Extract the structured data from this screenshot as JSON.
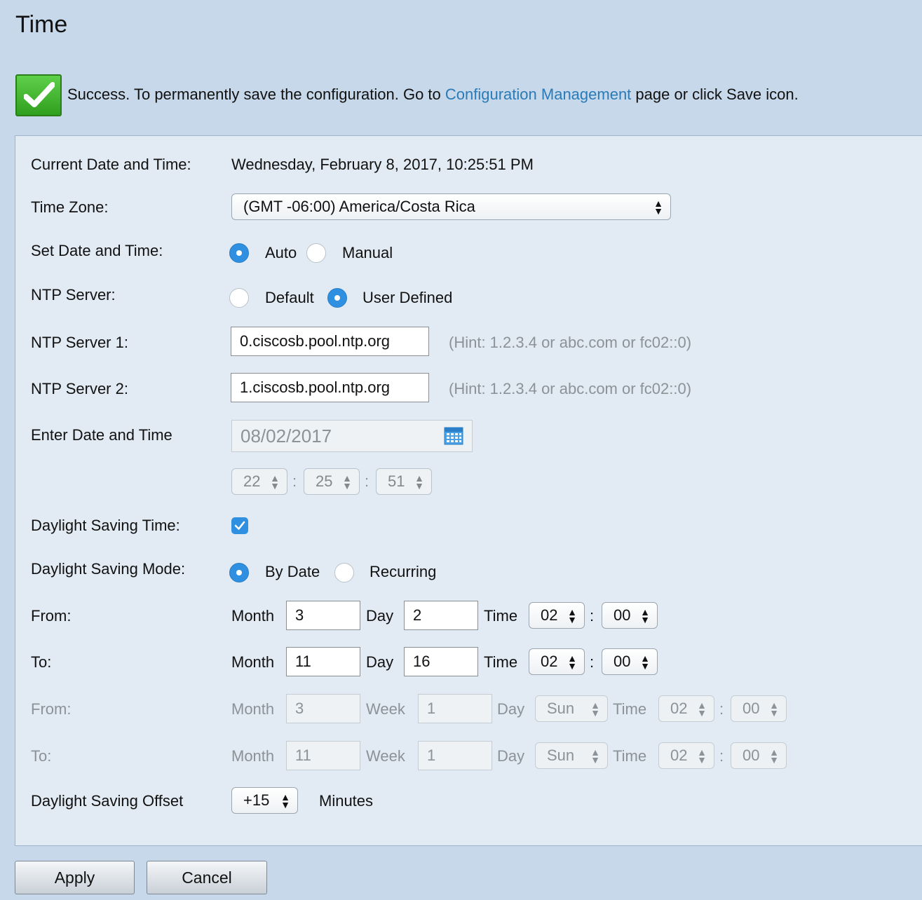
{
  "page": {
    "title": "Time"
  },
  "success": {
    "text_before": "Success. To permanently save the configuration. Go to ",
    "link": "Configuration Management",
    "text_after": " page or click Save icon."
  },
  "current": {
    "label": "Current Date and Time:",
    "value": "Wednesday, February 8, 2017, 10:25:51 PM"
  },
  "timezone": {
    "label": "Time Zone:",
    "value": "(GMT -06:00) America/Costa Rica"
  },
  "set_date_time": {
    "label": "Set Date and Time:",
    "options": [
      "Auto",
      "Manual"
    ],
    "selected": "Auto"
  },
  "ntp_server": {
    "label": "NTP Server:",
    "options": [
      "Default",
      "User Defined"
    ],
    "selected": "User Defined"
  },
  "ntp1": {
    "label": "NTP Server 1:",
    "value": "0.ciscosb.pool.ntp.org",
    "hint": "(Hint: 1.2.3.4 or abc.com or fc02::0)"
  },
  "ntp2": {
    "label": "NTP Server 2:",
    "value": "1.ciscosb.pool.ntp.org",
    "hint": "(Hint: 1.2.3.4 or abc.com or fc02::0)"
  },
  "enter_date": {
    "label": "Enter Date and Time",
    "date": "08/02/2017",
    "hour": "22",
    "minute": "25",
    "second": "51"
  },
  "dst": {
    "label": "Daylight Saving Time:",
    "checked": true
  },
  "dst_mode": {
    "label": "Daylight Saving Mode:",
    "options": [
      "By Date",
      "Recurring"
    ],
    "selected": "By Date"
  },
  "words": {
    "month": "Month",
    "day": "Day",
    "time": "Time",
    "week": "Week",
    "colon": ":"
  },
  "from_date": {
    "label": "From:",
    "month": "3",
    "day": "2",
    "hour": "02",
    "minute": "00"
  },
  "to_date": {
    "label": "To:",
    "month": "11",
    "day": "16",
    "hour": "02",
    "minute": "00"
  },
  "from_rec": {
    "label": "From:",
    "month": "3",
    "week": "1",
    "day": "Sun",
    "hour": "02",
    "minute": "00"
  },
  "to_rec": {
    "label": "To:",
    "month": "11",
    "week": "1",
    "day": "Sun",
    "hour": "02",
    "minute": "00"
  },
  "offset": {
    "label": "Daylight Saving Offset",
    "value": "+15",
    "unit": "Minutes"
  },
  "buttons": {
    "apply": "Apply",
    "cancel": "Cancel"
  },
  "colors": {
    "background": "#c6d8e9",
    "panel": "#e2ebf3",
    "link": "#2a7bb8",
    "accent": "#2f8fe0",
    "success": "#3fb52a"
  },
  "icons": {
    "success": "checkmark-icon",
    "calendar": "calendar-icon",
    "select_arrows": "updown-arrows-icon"
  }
}
